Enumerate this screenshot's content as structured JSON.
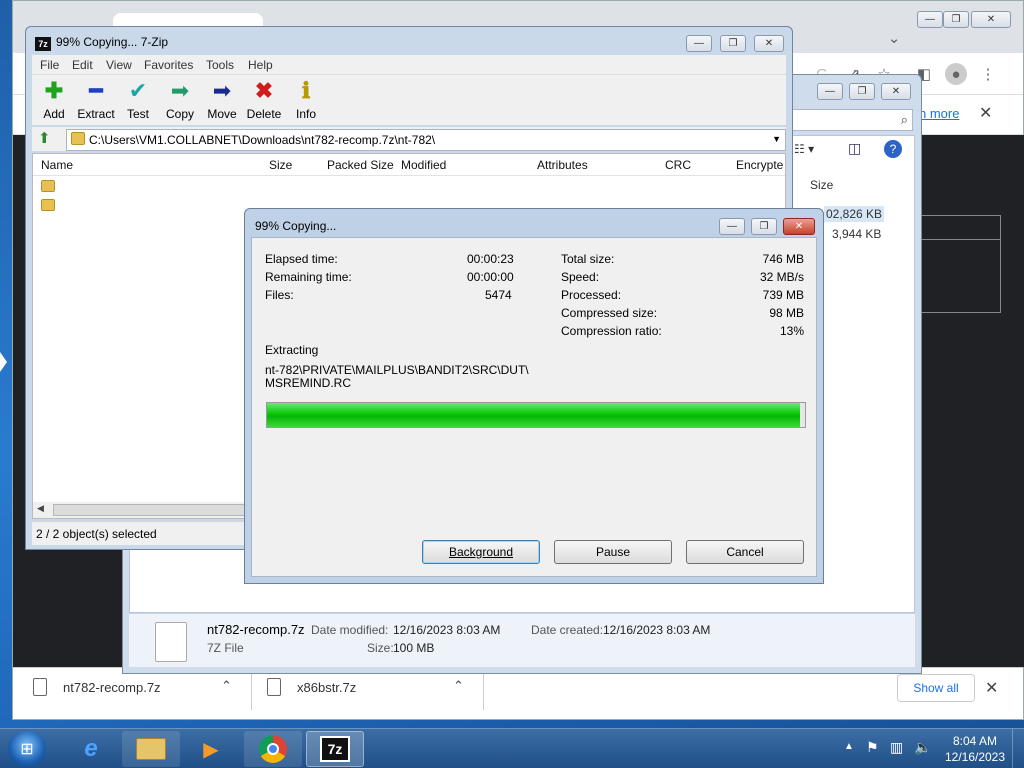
{
  "chrome": {
    "downloads": [
      {
        "name": "nt782-recomp.7z"
      },
      {
        "name": "x86bstr.7z"
      }
    ],
    "show_all": "Show all",
    "learn_more": "n more"
  },
  "explorer": {
    "column_size": "Size",
    "sizes": [
      "02,826 KB",
      "3,944 KB"
    ],
    "details": {
      "file_name": "nt782-recomp.7z",
      "file_type": "7Z File",
      "date_modified_label": "Date modified:",
      "date_modified": "12/16/2023 8:03 AM",
      "date_created_label": "Date created:",
      "date_created": "12/16/2023 8:03 AM",
      "size_label": "Size:",
      "size": "100 MB"
    }
  },
  "zip": {
    "title": "99% Copying... 7-Zip",
    "menu": [
      "File",
      "Edit",
      "View",
      "Favorites",
      "Tools",
      "Help"
    ],
    "toolbar": [
      {
        "label": "Add",
        "icon": "add-icon",
        "color": "#1fa31f"
      },
      {
        "label": "Extract",
        "icon": "extract-icon",
        "color": "#1f3fbf"
      },
      {
        "label": "Test",
        "icon": "test-icon",
        "color": "#1fa3a3"
      },
      {
        "label": "Copy",
        "icon": "copy-icon",
        "color": "#1f9b6b"
      },
      {
        "label": "Move",
        "icon": "move-icon",
        "color": "#1a2a8f"
      },
      {
        "label": "Delete",
        "icon": "delete-icon",
        "color": "#d01c1c"
      },
      {
        "label": "Info",
        "icon": "info-icon",
        "color": "#b59b00"
      }
    ],
    "path": "C:\\Users\\VM1.COLLABNET\\Downloads\\nt782-recomp.7z\\nt-782\\",
    "columns": [
      "Name",
      "Size",
      "Packed Size",
      "Modified",
      "Attributes",
      "CRC",
      "Encrypte"
    ],
    "status": "2 / 2 object(s) selected"
  },
  "dialog": {
    "title": "99% Copying...",
    "elapsed_label": "Elapsed time:",
    "elapsed": "00:00:23",
    "remaining_label": "Remaining time:",
    "remaining": "00:00:00",
    "files_label": "Files:",
    "files": "5474",
    "total_label": "Total size:",
    "total": "746 MB",
    "speed_label": "Speed:",
    "speed": "32 MB/s",
    "processed_label": "Processed:",
    "processed": "739 MB",
    "compressed_label": "Compressed size:",
    "compressed": "98 MB",
    "ratio_label": "Compression ratio:",
    "ratio": "13%",
    "action": "Extracting",
    "current_file_line1": "nt-782\\PRIVATE\\MAILPLUS\\BANDIT2\\SRC\\DUT\\",
    "current_file_line2": "MSREMIND.RC",
    "progress": 0.99,
    "buttons": {
      "background": "Background",
      "pause": "Pause",
      "cancel": "Cancel"
    }
  },
  "taskbar": {
    "time": "8:04 AM",
    "date": "12/16/2023"
  }
}
